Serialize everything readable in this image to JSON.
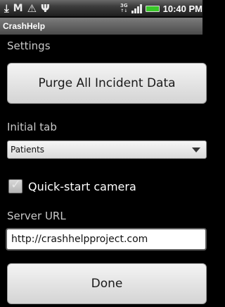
{
  "status_bar": {
    "left_icons": [
      "download-icon",
      "gmail-icon",
      "warning-icon",
      "usb-icon"
    ],
    "network_label": "3G",
    "time": "10:40 PM"
  },
  "app": {
    "title": "CrashHelp"
  },
  "settings": {
    "heading": "Settings",
    "purge_button": "Purge All Incident Data",
    "initial_tab": {
      "label": "Initial tab",
      "selected": "Patients"
    },
    "quick_start_camera": {
      "label": "Quick-start camera",
      "checked": true
    },
    "server_url": {
      "label": "Server URL",
      "value": "http://crashhelpproject.com"
    },
    "done_button": "Done"
  }
}
